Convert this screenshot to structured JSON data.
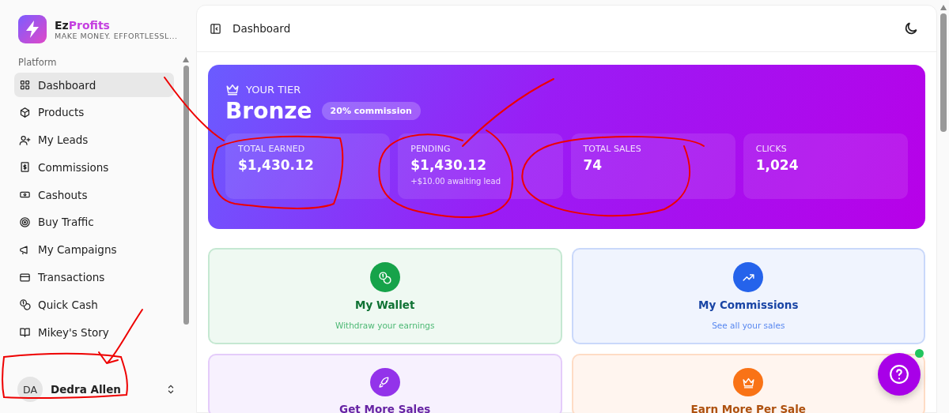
{
  "brand": {
    "name_first": "Ez",
    "name_second": "Profits",
    "tagline": "MAKE MONEY. EFFORTLESSL..."
  },
  "sidebar": {
    "section": "Platform",
    "items": [
      {
        "label": "Dashboard",
        "selected": true
      },
      {
        "label": "Products",
        "selected": false
      },
      {
        "label": "My Leads",
        "selected": false
      },
      {
        "label": "Commissions",
        "selected": false
      },
      {
        "label": "Cashouts",
        "selected": false
      },
      {
        "label": "Buy Traffic",
        "selected": false
      },
      {
        "label": "My Campaigns",
        "selected": false
      },
      {
        "label": "Transactions",
        "selected": false
      },
      {
        "label": "Quick Cash",
        "selected": false
      },
      {
        "label": "Mikey's Story",
        "selected": false
      }
    ],
    "user": {
      "initials": "DA",
      "name": "Dedra Allen"
    }
  },
  "header": {
    "title": "Dashboard"
  },
  "tier": {
    "label": "YOUR TIER",
    "name": "Bronze",
    "badge": "20% commission",
    "stats": [
      {
        "label": "TOTAL EARNED",
        "value": "$1,430.12"
      },
      {
        "label": "PENDING",
        "value": "$1,430.12",
        "note": "+$10.00 awaiting lead"
      },
      {
        "label": "TOTAL SALES",
        "value": "74"
      },
      {
        "label": "CLICKS",
        "value": "1,024"
      }
    ]
  },
  "cards": [
    {
      "title": "My Wallet",
      "subtitle": "Withdraw your earnings",
      "color": "#16a34a"
    },
    {
      "title": "My Commissions",
      "subtitle": "See all your sales",
      "color": "#2563eb"
    },
    {
      "title": "Get More Sales",
      "color": "#9333ea"
    },
    {
      "title": "Earn More Per Sale",
      "color": "#f97316"
    }
  ]
}
